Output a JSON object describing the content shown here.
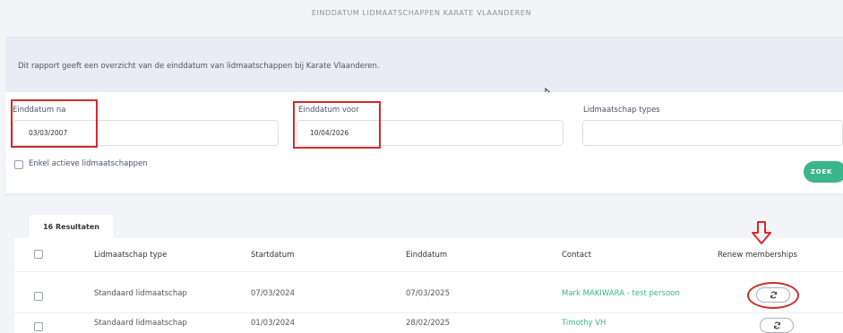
{
  "page": {
    "title": "EINDDATUM LIDMAATSCHAPPEN KARATE VLAANDEREN"
  },
  "info": {
    "text": "Dit rapport geeft een overzicht van de einddatum van lidmaatschappen bij Karate Vlaanderen."
  },
  "filters": {
    "einddatum_na": {
      "label": "Einddatum na",
      "value": "03/03/2007"
    },
    "einddatum_voor": {
      "label": "Einddatum voor",
      "value": "10/04/2026"
    },
    "lidmaatschap_types": {
      "label": "Lidmaatschap types",
      "value": ""
    },
    "enkel_actieve": {
      "label": "Enkel actieve lidmaatschappen",
      "checked": false
    },
    "zoek_label": "ZOEK"
  },
  "results": {
    "tab_label": "16 Resultaten",
    "columns": [
      "Lidmaatschap type",
      "Startdatum",
      "Einddatum",
      "Contact",
      "Renew memberships"
    ],
    "rows": [
      {
        "type": "Standaard lidmaatschap",
        "start": "07/03/2024",
        "end": "07/03/2025",
        "contact": "Mark MAKIWARA - test persoon"
      },
      {
        "type": "Standaard lidmaatschap",
        "start": "01/03/2024",
        "end": "28/02/2025",
        "contact": "Timothy VH"
      }
    ]
  },
  "colors": {
    "accent": "#3bb58c",
    "annotation": "#d12b2b",
    "info_bg": "#e9ecf4"
  },
  "icons": {
    "renew": "refresh-icon",
    "annotation_arrow": "down-arrow-icon",
    "cursor": "mouse-cursor-icon"
  }
}
